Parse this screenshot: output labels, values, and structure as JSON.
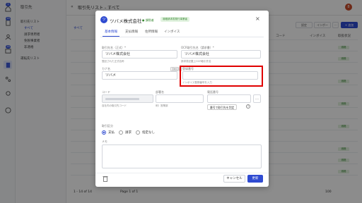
{
  "rail": {
    "badges": [
      "1",
      "16",
      "16"
    ],
    "avatar": "S"
  },
  "sidemenu": {
    "title": "取引先",
    "items": [
      "取引先リスト",
      "すべて",
      "請求専用者",
      "免税事業者",
      "非適格",
      "運転先リスト"
    ]
  },
  "topbar": {
    "title": "取引先リスト - すべて",
    "user_badge": "8"
  },
  "toolbar": {
    "settings": "設定",
    "import": "インポー",
    "more": "⋯",
    "new": "+ 追加"
  },
  "table": {
    "tab_all": "すべて",
    "headers": [
      "コード",
      "インボイス",
      "取扱状況"
    ],
    "tags": [
      "適格",
      "適格",
      "適格",
      "適格",
      "適格",
      "適格",
      "適格",
      "適格"
    ],
    "pagination": "1 - 14 of 14",
    "page_label": "Page 1 of 1",
    "page_size": "100"
  },
  "modal": {
    "logo": "ツ",
    "title": "ツバメ株式会社",
    "status": "● 課税者",
    "status_tag": "適格請求書発行事業者",
    "tabs": [
      "基本情報",
      "支払情報",
      "住所情報",
      "インボイス"
    ],
    "fields": {
      "name_label": "取引先名（正式）*",
      "name_value": "ツバメ株式会社",
      "name_hint": "登記された正式名称",
      "ocr_label": "OCR取引先名（請求書）*",
      "ocr_value": "ツバメ株式会社",
      "ocr_hint": "請求書記載上OCR取引先名",
      "kana_label": "カナ名",
      "kana_value": "ツバメ",
      "kana_tag": "自動反映",
      "reg_label": "登録番号",
      "reg_value": "",
      "reg_hint": "インボイス登録番号を入力",
      "code_label": "コード",
      "code_hint": "自社内の取引先コード",
      "dept_label": "部署名",
      "dept_hint": "例）営業部",
      "tel_label": "電話番号",
      "remark_checkbox": "番号で取引先を判定",
      "type_label": "取引区分",
      "radios": [
        "支払",
        "請求",
        "指定なし"
      ],
      "memo_label": "メモ"
    },
    "buttons": {
      "cancel": "キャンセル",
      "save": "更新"
    },
    "highlight_color": "#e00000"
  }
}
